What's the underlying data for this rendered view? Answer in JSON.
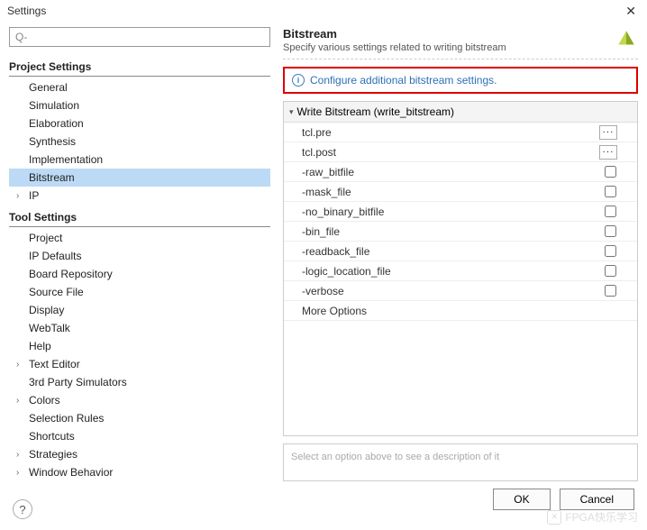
{
  "window": {
    "title": "Settings"
  },
  "search": {
    "placeholder": "Q-"
  },
  "tree": {
    "project_section": "Project Settings",
    "project_items": [
      "General",
      "Simulation",
      "Elaboration",
      "Synthesis",
      "Implementation",
      "Bitstream",
      "IP"
    ],
    "selected": "Bitstream",
    "tool_section": "Tool Settings",
    "tool_items": [
      "Project",
      "IP Defaults",
      "Board Repository",
      "Source File",
      "Display",
      "WebTalk",
      "Help",
      "Text Editor",
      "3rd Party Simulators",
      "Colors",
      "Selection Rules",
      "Shortcuts",
      "Strategies",
      "Window Behavior"
    ],
    "expandable": [
      "Text Editor",
      "Colors",
      "Strategies",
      "Window Behavior"
    ]
  },
  "header": {
    "title": "Bitstream",
    "desc": "Specify various settings related to writing bitstream"
  },
  "config_link": "Configure additional bitstream settings.",
  "options": {
    "group_title": "Write Bitstream (write_bitstream)",
    "rows": [
      {
        "label": "tcl.pre",
        "type": "browse"
      },
      {
        "label": "tcl.post",
        "type": "browse"
      },
      {
        "label": "-raw_bitfile",
        "type": "check"
      },
      {
        "label": "-mask_file",
        "type": "check"
      },
      {
        "label": "-no_binary_bitfile",
        "type": "check"
      },
      {
        "label": "-bin_file",
        "type": "check"
      },
      {
        "label": "-readback_file",
        "type": "check"
      },
      {
        "label": "-logic_location_file",
        "type": "check"
      },
      {
        "label": "-verbose",
        "type": "check"
      },
      {
        "label": "More Options",
        "type": "none"
      }
    ]
  },
  "desc_placeholder": "Select an option above to see a description of it",
  "buttons": {
    "ok": "OK",
    "cancel": "Cancel"
  },
  "watermark": "FPGA快乐学习"
}
